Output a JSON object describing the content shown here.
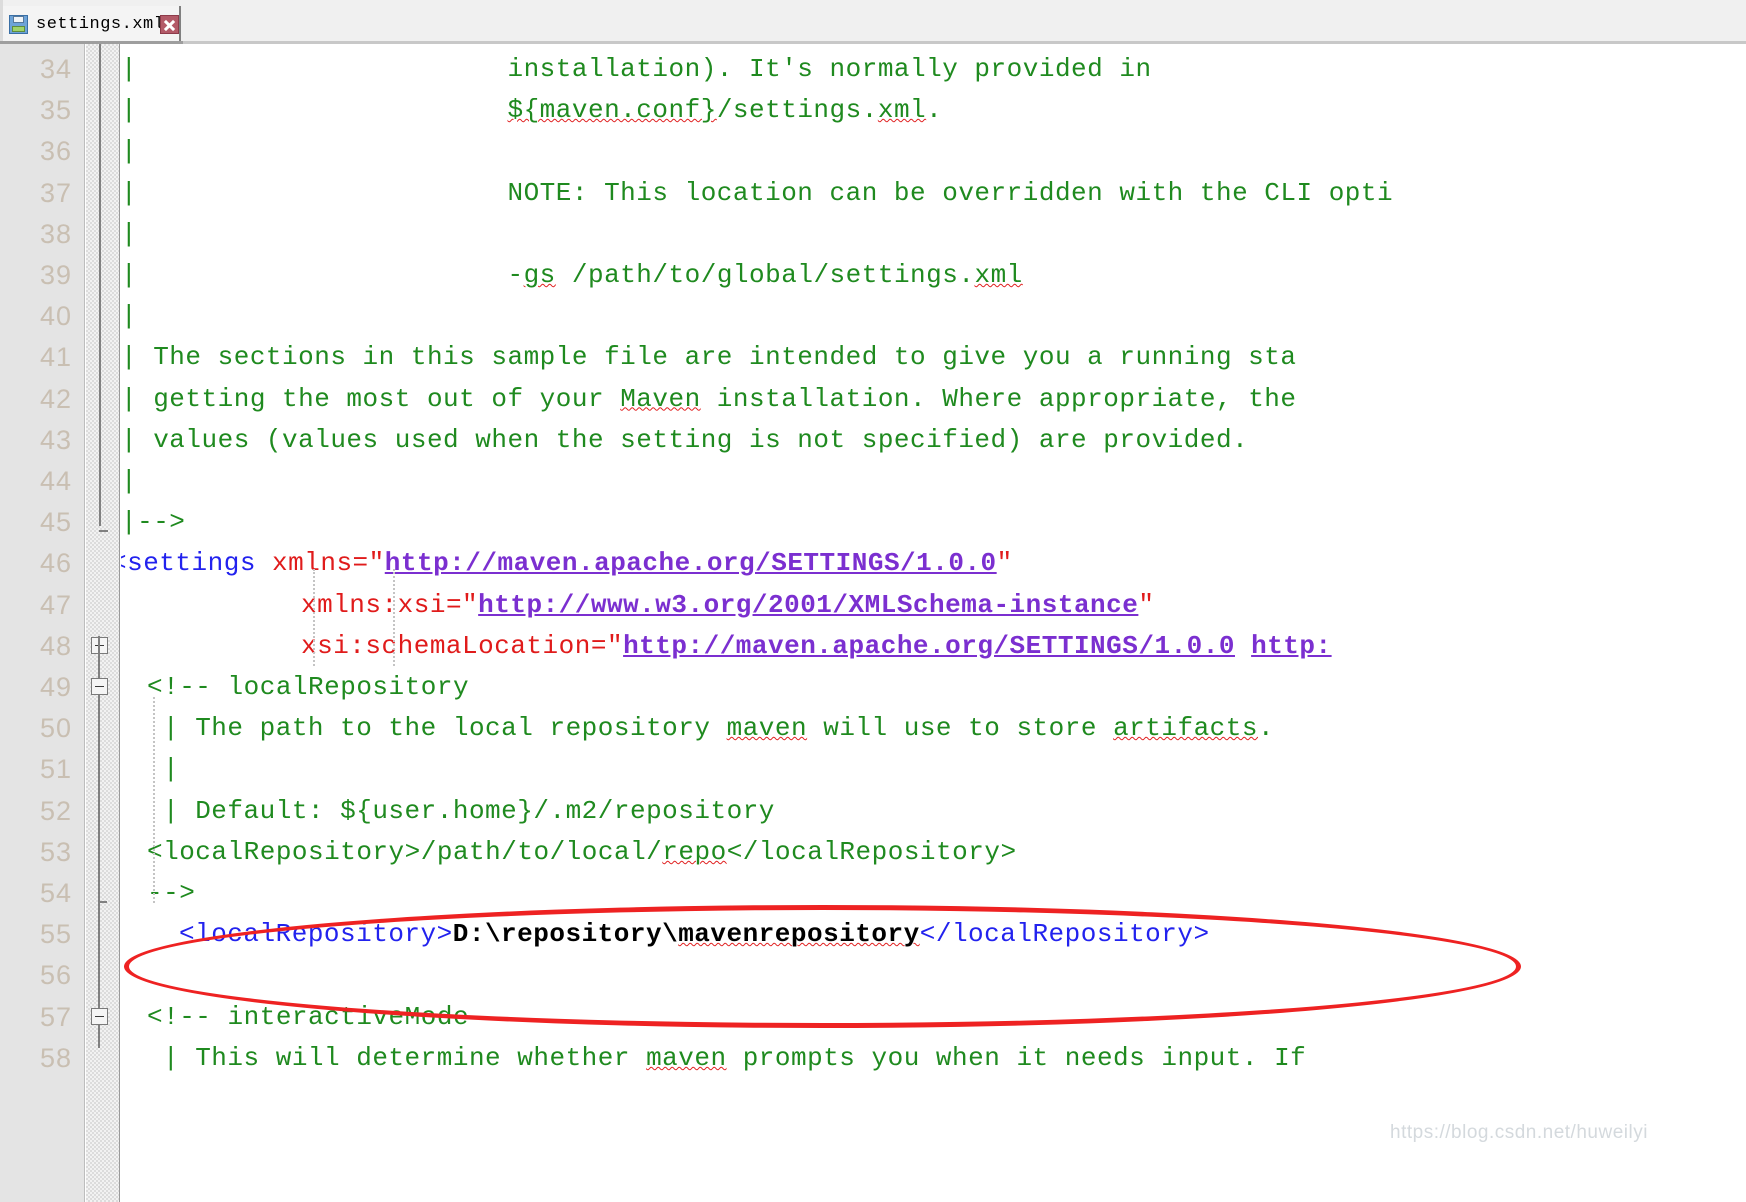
{
  "window": {
    "tab": {
      "title": "settings.xml",
      "save_icon": "floppy-disk-save-icon",
      "close_icon": "close-x-icon",
      "accent_color": "#f5a33c"
    }
  },
  "editor": {
    "language": "xml",
    "first_visible_line": 34,
    "last_visible_line": 58,
    "colors": {
      "comment": "#1f8a1f",
      "tag": "#2222ee",
      "attribute": "#e01b1b",
      "url": "#7b2fd0",
      "text_value": "#000000",
      "line_number": "#c9bfb2",
      "gutter_background": "#e4e4e4",
      "editor_background": "#ffffff",
      "annotation": "#ee2222",
      "spellcheck_squiggle": "#e02020"
    },
    "lines": [
      {
        "n": "34",
        "indent": 0,
        "segs": [
          {
            "t": "|                       installation). It's normally provided in",
            "c": "c-comment"
          }
        ]
      },
      {
        "n": "35",
        "indent": 0,
        "segs": [
          {
            "t": "|                       ",
            "c": "c-comment"
          },
          {
            "t": "${maven.conf}",
            "c": "c-comment spell"
          },
          {
            "t": "/settings.",
            "c": "c-comment"
          },
          {
            "t": "xml",
            "c": "c-comment spell"
          },
          {
            "t": ".",
            "c": "c-comment"
          }
        ]
      },
      {
        "n": "36",
        "indent": 0,
        "segs": [
          {
            "t": "|",
            "c": "c-comment"
          }
        ]
      },
      {
        "n": "37",
        "indent": 0,
        "segs": [
          {
            "t": "|                       NOTE: This location can be overridden with the CLI opti",
            "c": "c-comment"
          }
        ]
      },
      {
        "n": "38",
        "indent": 0,
        "segs": [
          {
            "t": "|",
            "c": "c-comment"
          }
        ]
      },
      {
        "n": "39",
        "indent": 0,
        "segs": [
          {
            "t": "|                       -",
            "c": "c-comment"
          },
          {
            "t": "gs",
            "c": "c-comment spell"
          },
          {
            "t": " /path/to/global/settings.",
            "c": "c-comment"
          },
          {
            "t": "xml",
            "c": "c-comment spell"
          }
        ]
      },
      {
        "n": "40",
        "indent": 0,
        "segs": [
          {
            "t": "|",
            "c": "c-comment"
          }
        ]
      },
      {
        "n": "41",
        "indent": 0,
        "segs": [
          {
            "t": "| The sections in this sample file are intended to give you a running sta",
            "c": "c-comment"
          }
        ]
      },
      {
        "n": "42",
        "indent": 0,
        "segs": [
          {
            "t": "| getting the most out of your ",
            "c": "c-comment"
          },
          {
            "t": "Maven",
            "c": "c-comment spell"
          },
          {
            "t": " installation. Where appropriate, the",
            "c": "c-comment"
          }
        ]
      },
      {
        "n": "43",
        "indent": 0,
        "segs": [
          {
            "t": "| values (values used when the setting is not specified) are provided.",
            "c": "c-comment"
          }
        ]
      },
      {
        "n": "44",
        "indent": 0,
        "segs": [
          {
            "t": "|",
            "c": "c-comment"
          }
        ]
      },
      {
        "n": "45",
        "indent": 0,
        "segs": [
          {
            "t": "|-->",
            "c": "c-comment"
          }
        ]
      },
      {
        "n": "46",
        "indent": -10,
        "segs": [
          {
            "t": "<settings ",
            "c": "c-tag"
          },
          {
            "t": "xmlns",
            "c": "c-attr"
          },
          {
            "t": "=",
            "c": "c-attr"
          },
          {
            "t": "\"",
            "c": "c-quote"
          },
          {
            "t": "http://maven.apache.org/SETTINGS/1.0.0",
            "c": "c-url"
          },
          {
            "t": "\"",
            "c": "c-quote"
          }
        ]
      },
      {
        "n": "47",
        "indent": 180,
        "segs": [
          {
            "t": "xmlns:xsi",
            "c": "c-attr"
          },
          {
            "t": "=",
            "c": "c-attr"
          },
          {
            "t": "\"",
            "c": "c-quote"
          },
          {
            "t": "http://www.w3.org/2001/XMLSchema-instance",
            "c": "c-url"
          },
          {
            "t": "\"",
            "c": "c-quote"
          }
        ]
      },
      {
        "n": "48",
        "indent": 180,
        "segs": [
          {
            "t": "xsi:schemaLocation",
            "c": "c-attr"
          },
          {
            "t": "=",
            "c": "c-attr"
          },
          {
            "t": "\"",
            "c": "c-quote"
          },
          {
            "t": "http://maven.apache.org/SETTINGS/1.0.0",
            "c": "c-url"
          },
          {
            "t": " ",
            "c": "c-quote"
          },
          {
            "t": "http:",
            "c": "c-url"
          }
        ]
      },
      {
        "n": "49",
        "indent": 26,
        "segs": [
          {
            "t": "<!-- localRepository",
            "c": "c-comment"
          }
        ]
      },
      {
        "n": "50",
        "indent": 42,
        "segs": [
          {
            "t": "| The path to the local repository ",
            "c": "c-comment"
          },
          {
            "t": "maven",
            "c": "c-comment spell"
          },
          {
            "t": " will use to store ",
            "c": "c-comment"
          },
          {
            "t": "artifacts",
            "c": "c-comment spell"
          },
          {
            "t": ".",
            "c": "c-comment"
          }
        ]
      },
      {
        "n": "51",
        "indent": 42,
        "segs": [
          {
            "t": "|",
            "c": "c-comment"
          }
        ]
      },
      {
        "n": "52",
        "indent": 42,
        "segs": [
          {
            "t": "| Default: ${user.home}/.m2/repository",
            "c": "c-comment"
          }
        ]
      },
      {
        "n": "53",
        "indent": 26,
        "segs": [
          {
            "t": "<localRepository>/path/to/local/",
            "c": "c-comment"
          },
          {
            "t": "repo",
            "c": "c-comment spell"
          },
          {
            "t": "</localRepository>",
            "c": "c-comment"
          }
        ]
      },
      {
        "n": "54",
        "indent": 26,
        "segs": [
          {
            "t": "-->",
            "c": "c-comment"
          }
        ]
      },
      {
        "n": "55",
        "indent": 58,
        "segs": [
          {
            "t": "<localRepository>",
            "c": "c-tag"
          },
          {
            "t": "D:\\repository\\",
            "c": "c-text"
          },
          {
            "t": "mavenrepository",
            "c": "c-text spell"
          },
          {
            "t": "</localRepository>",
            "c": "c-tag"
          }
        ]
      },
      {
        "n": "56",
        "indent": 0,
        "segs": []
      },
      {
        "n": "57",
        "indent": 26,
        "segs": [
          {
            "t": "<!-- interactiveMode",
            "c": "c-comment"
          }
        ]
      },
      {
        "n": "58",
        "indent": 42,
        "segs": [
          {
            "t": "| This will determine whether ",
            "c": "c-comment"
          },
          {
            "t": "maven",
            "c": "c-comment spell"
          },
          {
            "t": " prompts you when it needs input. If",
            "c": "c-comment"
          }
        ]
      }
    ],
    "fold_markers": [
      {
        "line": "48",
        "state": "expanded",
        "icon": "fold-collapse-icon"
      },
      {
        "line": "49",
        "state": "expanded",
        "icon": "fold-collapse-icon"
      },
      {
        "line": "57",
        "state": "expanded",
        "icon": "fold-collapse-icon"
      }
    ],
    "annotation": {
      "type": "ellipse",
      "color": "#ee2222",
      "targets_line": "55",
      "highlighted_value": "D:\\repository\\mavenrepository"
    }
  },
  "watermark": {
    "text": "https://blog.csdn.net/huweilyi"
  }
}
